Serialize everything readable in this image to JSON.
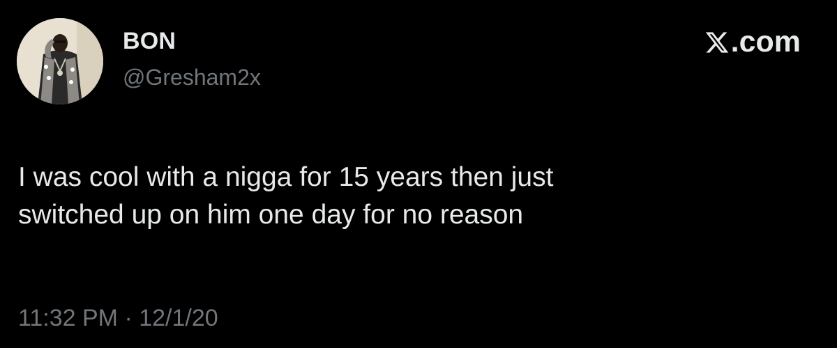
{
  "author": {
    "display_name": "BON",
    "handle": "@Gresham2x",
    "avatar_icon": "user-avatar"
  },
  "brand": {
    "label": ".com",
    "icon": "x-logo-icon"
  },
  "tweet": {
    "lines": [
      "I was cool with a nigga for 15 years then just",
      "switched up on him one day for no reason"
    ],
    "timestamp": "11:32 PM · 12/1/20"
  },
  "colors": {
    "background": "#000000",
    "primary_text": "#e7e9ea",
    "secondary_text": "#71767b"
  }
}
